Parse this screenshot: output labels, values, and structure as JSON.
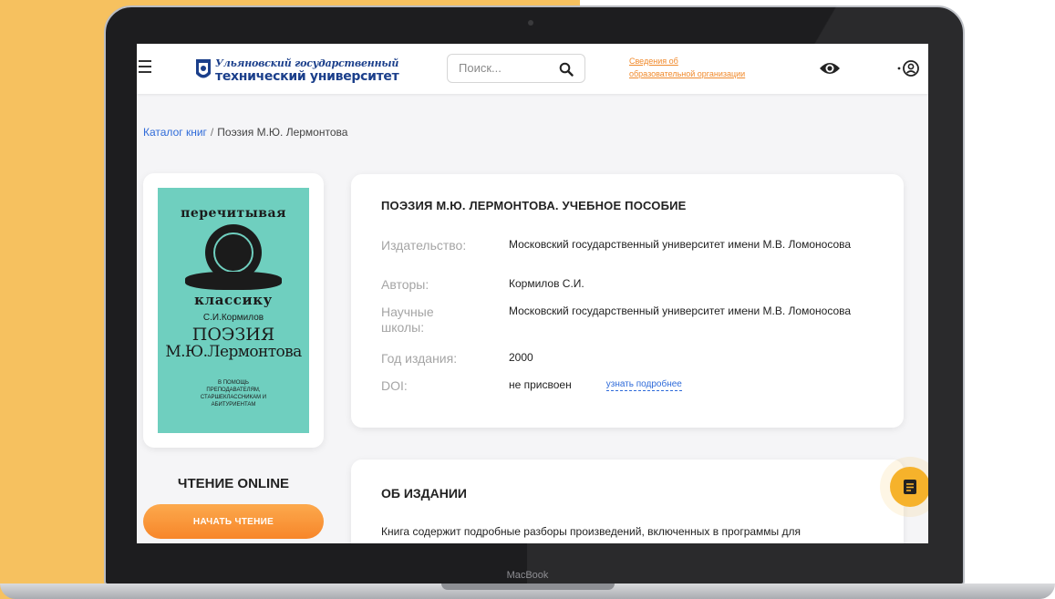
{
  "device": {
    "label": "MacBook"
  },
  "header": {
    "logo": {
      "line1": "Ульяновский государственный",
      "line2": "технический университет"
    },
    "search": {
      "placeholder": "Поиск..."
    },
    "org_link": {
      "line1": "Сведения об",
      "line2": "образовательной организации"
    },
    "icons": [
      "menu-icon",
      "search-icon",
      "eye-icon",
      "user-icon"
    ]
  },
  "breadcrumb": {
    "root": "Каталог книг",
    "separator": "/",
    "current": "Поэзия М.Ю. Лермонтова"
  },
  "cover": {
    "top_text": "перечитывая",
    "middle_text": "классику",
    "author": "С.И.Кормилов",
    "title_line1": "ПОЭЗИЯ",
    "title_line2": "М.Ю.Лермонтова",
    "subtitle": "В помощь преподавателям, старшеклассникам и абитуриентам"
  },
  "reading": {
    "title": "ЧТЕНИЕ ONLINE",
    "button_label": "НАЧАТЬ ЧТЕНИЕ"
  },
  "book": {
    "title": "ПОЭЗИЯ М.Ю. ЛЕРМОНТОВА. УЧЕБНОЕ ПОСОБИЕ",
    "fields": [
      {
        "label": "Издательство:",
        "value": "Московский государственный университет имени М.В. Ломоносова"
      },
      {
        "label": "Авторы:",
        "value": "Кормилов С.И."
      },
      {
        "label": "Научные школы:",
        "value": "Московский государственный университет имени М.В. Ломоносова"
      },
      {
        "label": "Год издания:",
        "value": "2000"
      },
      {
        "label": "DOI:",
        "value": "не присвоен",
        "link": "узнать подробнее"
      }
    ]
  },
  "about": {
    "title": "ОБ ИЗДАНИИ",
    "text": "Книга содержит подробные разборы произведений, включенных в программы для"
  },
  "colors": {
    "accent": "#f7862a",
    "link": "#2f6bd9",
    "background": "#f6c15f",
    "cover": "#6fcfbf"
  }
}
